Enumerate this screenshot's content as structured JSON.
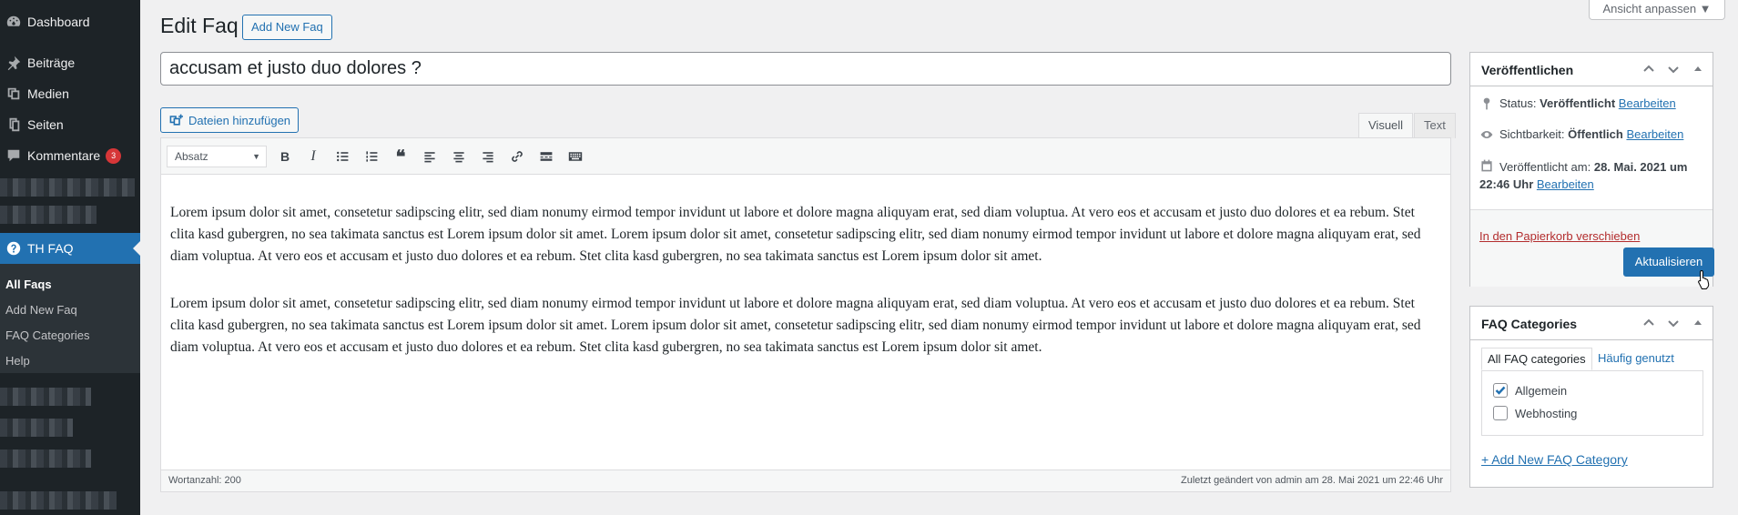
{
  "sidebar": {
    "dashboard": "Dashboard",
    "beitraege": "Beiträge",
    "medien": "Medien",
    "seiten": "Seiten",
    "kommentare": "Kommentare",
    "kommentare_count": "3",
    "th_faq": "TH FAQ",
    "submenu": [
      "All Faqs",
      "Add New Faq",
      "FAQ Categories",
      "Help"
    ]
  },
  "header": {
    "title": "Edit Faq",
    "add_new": "Add New Faq",
    "screen_options": "Ansicht anpassen ▼"
  },
  "post": {
    "title": "accusam et justo duo dolores ?",
    "add_media": "Dateien hinzufügen",
    "tab_visual": "Visuell",
    "tab_text": "Text",
    "format": "Absatz",
    "paragraphs": [
      "Lorem ipsum dolor sit amet, consetetur sadipscing elitr, sed diam nonumy eirmod tempor invidunt ut labore et dolore magna aliquyam erat, sed diam voluptua. At vero eos et accusam et justo duo dolores et ea rebum. Stet clita kasd gubergren, no sea takimata sanctus est Lorem ipsum dolor sit amet. Lorem ipsum dolor sit amet, consetetur sadipscing elitr, sed diam nonumy eirmod tempor invidunt ut labore et dolore magna aliquyam erat, sed diam voluptua. At vero eos et accusam et justo duo dolores et ea rebum. Stet clita kasd gubergren, no sea takimata sanctus est Lorem ipsum dolor sit amet.",
      "Lorem ipsum dolor sit amet, consetetur sadipscing elitr, sed diam nonumy eirmod tempor invidunt ut labore et dolore magna aliquyam erat, sed diam voluptua. At vero eos et accusam et justo duo dolores et ea rebum. Stet clita kasd gubergren, no sea takimata sanctus est Lorem ipsum dolor sit amet. Lorem ipsum dolor sit amet, consetetur sadipscing elitr, sed diam nonumy eirmod tempor invidunt ut labore et dolore magna aliquyam erat, sed diam voluptua. At vero eos et accusam et justo duo dolores et ea rebum. Stet clita kasd gubergren, no sea takimata sanctus est Lorem ipsum dolor sit amet."
    ],
    "word_count": "Wortanzahl: 200",
    "last_edited": "Zuletzt geändert von admin am 28. Mai 2021 um 22:46 Uhr"
  },
  "publish": {
    "title": "Veröffentlichen",
    "status_label": "Status:",
    "status_value": "Veröffentlicht",
    "visibility_label": "Sichtbarkeit:",
    "visibility_value": "Öffentlich",
    "published_label": "Veröffentlicht am:",
    "published_value": "28. Mai. 2021 um",
    "published_time": "22:46 Uhr",
    "edit": "Bearbeiten",
    "trash": "In den Papierkorb verschieben",
    "update": "Aktualisieren"
  },
  "faq_categories": {
    "title": "FAQ Categories",
    "tab_all": "All FAQ categories",
    "tab_popular": "Häufig genutzt",
    "items": [
      {
        "label": "Allgemein",
        "checked": true
      },
      {
        "label": "Webhosting",
        "checked": false
      }
    ],
    "add_new": "+ Add New FAQ Category"
  },
  "colors": {
    "accent": "#2271b1",
    "sidebar_bg": "#1d2327",
    "danger": "#b32d2e",
    "badge": "#d63638"
  }
}
